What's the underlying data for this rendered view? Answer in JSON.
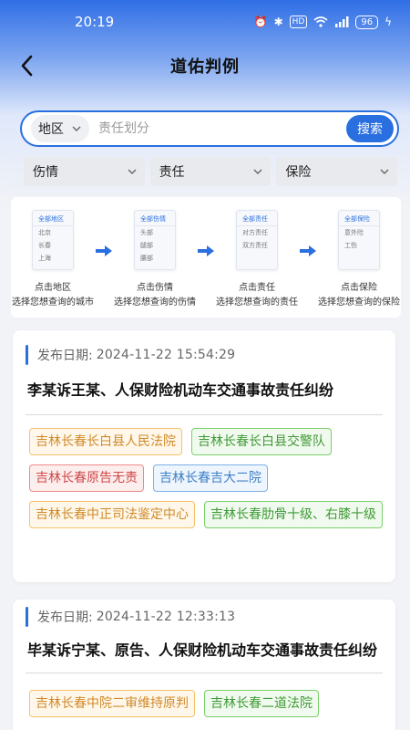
{
  "status": {
    "time": "20:19",
    "battery": "96",
    "hd": "HD"
  },
  "header": {
    "title": "道佑判例"
  },
  "search": {
    "region": "地区",
    "placeholder": "责任划分",
    "button": "搜索"
  },
  "filters": [
    "伤情",
    "责任",
    "保险"
  ],
  "guide": {
    "steps": [
      {
        "card": [
          "全部地区",
          "北京",
          "长春",
          "上海"
        ],
        "line1": "点击地区",
        "line2": "选择您想查询的城市"
      },
      {
        "card": [
          "全部伤情",
          "头部",
          "腿部",
          "腰部"
        ],
        "line1": "点击伤情",
        "line2": "选择您想查询的伤情"
      },
      {
        "card": [
          "全部责任",
          "对方责任",
          "双方责任"
        ],
        "line1": "点击责任",
        "line2": "选择您想查询的责任"
      },
      {
        "card": [
          "全部保险",
          "意外险",
          "工伤"
        ],
        "line1": "点击保险",
        "line2": "选择您想查询的保险"
      }
    ]
  },
  "cases": [
    {
      "date_label": "发布日期:",
      "date": "2024-11-22 15:54:29",
      "title": "李某诉王某、人保财险机动车交通事故责任纠纷",
      "tags": [
        {
          "text": "吉林长春长白县人民法院",
          "color": "orange"
        },
        {
          "text": "吉林长春长白县交警队",
          "color": "green"
        },
        {
          "text": "吉林长春原告无责",
          "color": "red"
        },
        {
          "text": "吉林长春吉大二院",
          "color": "blue"
        },
        {
          "text": "吉林长春中正司法鉴定中心",
          "color": "orange"
        },
        {
          "text": "吉林长春肋骨十级、右膝十级",
          "color": "green"
        }
      ]
    },
    {
      "date_label": "发布日期:",
      "date": "2024-11-22 12:33:13",
      "title": "毕某诉宁某、原告、人保财险机动车交通事故责任纠纷",
      "tags": [
        {
          "text": "吉林长春中院二审维持原判",
          "color": "orange"
        },
        {
          "text": "吉林长春二道法院",
          "color": "green"
        }
      ]
    }
  ],
  "colors": {
    "accent": "#2a6fe0",
    "header_gradient_top": "#2f6fe6"
  }
}
